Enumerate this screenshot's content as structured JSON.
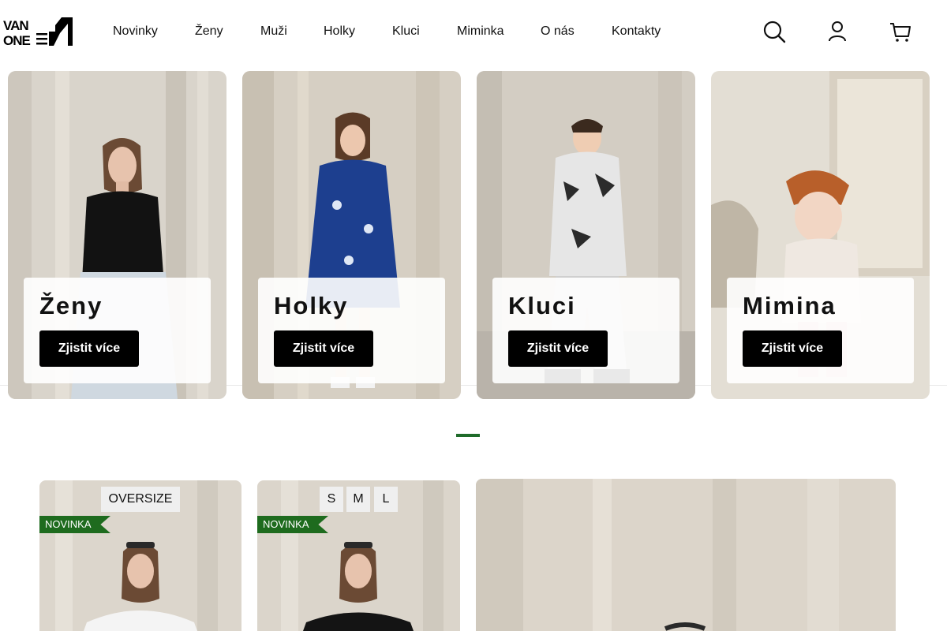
{
  "brand": {
    "logo_line1": "VAN",
    "logo_line2": "ONE"
  },
  "nav": {
    "items": [
      {
        "label": "Novinky"
      },
      {
        "label": "Ženy"
      },
      {
        "label": "Muži"
      },
      {
        "label": "Holky"
      },
      {
        "label": "Kluci"
      },
      {
        "label": "Miminka"
      },
      {
        "label": "O nás"
      },
      {
        "label": "Kontakty"
      }
    ]
  },
  "header_icons": [
    "search-icon",
    "user-icon",
    "cart-icon"
  ],
  "categories": [
    {
      "title": "Ženy",
      "button": "Zjistit více"
    },
    {
      "title": "Holky",
      "button": "Zjistit více"
    },
    {
      "title": "Kluci",
      "button": "Zjistit více"
    },
    {
      "title": "Mimina",
      "button": "Zjistit více"
    }
  ],
  "products": [
    {
      "tag": "OVERSIZE",
      "badge": "NOVINKA"
    },
    {
      "sizes": [
        "S",
        "M",
        "L"
      ],
      "badge": "NOVINKA"
    }
  ],
  "colors": {
    "accent_green": "#1e6b1e",
    "button_black": "#000000"
  }
}
